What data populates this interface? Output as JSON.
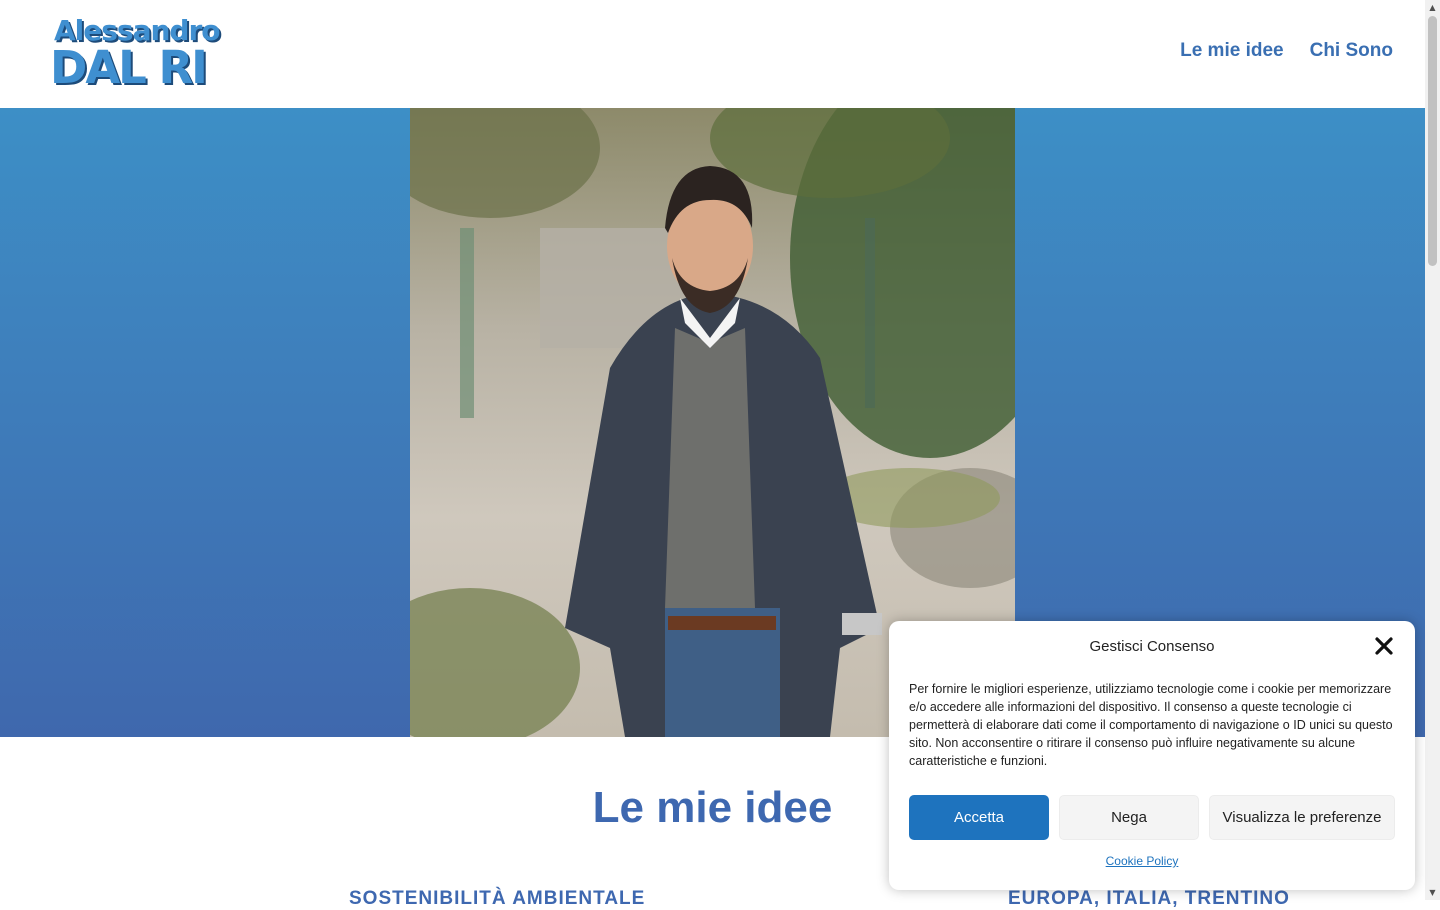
{
  "header": {
    "logo": {
      "line1": "Alessandro",
      "line2": "DAL RI"
    },
    "nav": [
      {
        "label": "Le mie idee"
      },
      {
        "label": "Chi Sono"
      }
    ]
  },
  "hero": {
    "photo_icon": "portrait-photo",
    "colors": {
      "gradient_top": "#3d8fc6",
      "gradient_bottom": "#3f68ad"
    }
  },
  "section": {
    "title": "Le mie idee",
    "subheadings": [
      "SOSTENIBILITÀ AMBIENTALE",
      "EUROPA, ITALIA, TRENTINO"
    ]
  },
  "cookie_dialog": {
    "title": "Gestisci Consenso",
    "close_icon": "close-icon",
    "text": "Per fornire le migliori esperienze, utilizziamo tecnologie come i cookie per memorizzare e/o accedere alle informazioni del dispositivo. Il consenso a queste tecnologie ci permetterà di elaborare dati come il comportamento di navigazione o ID unici su questo sito. Non acconsentire o ritirare il consenso può influire negativamente su alcune caratteristiche e funzioni.",
    "buttons": {
      "accept": "Accetta",
      "deny": "Nega",
      "preferences": "Visualizza le preferenze"
    },
    "policy_link": "Cookie Policy"
  },
  "colors": {
    "brand": "#3e68b0",
    "accept_button": "#1e73be"
  }
}
